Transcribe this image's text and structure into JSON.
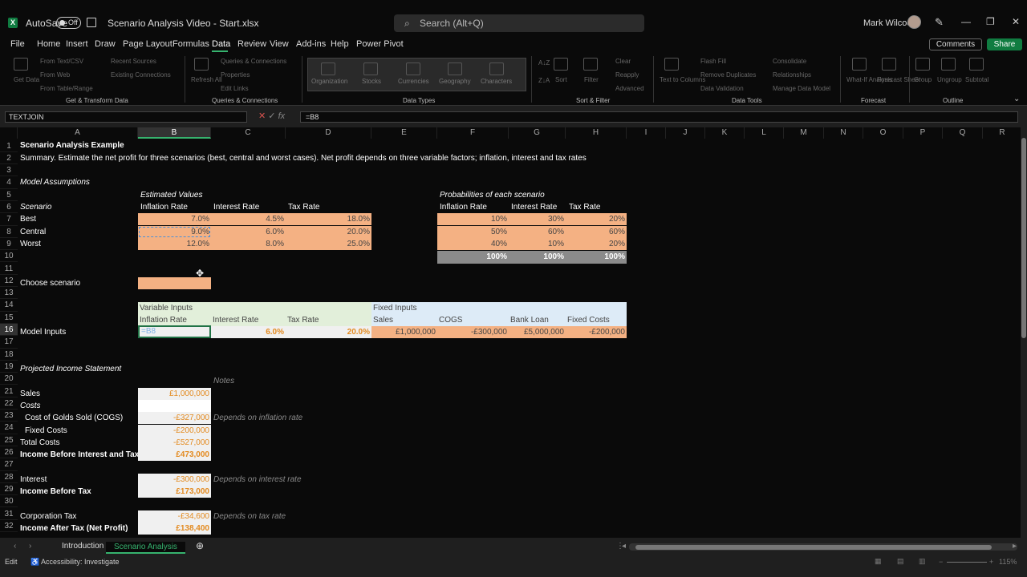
{
  "titlebar": {
    "logo": "X",
    "autosave_label": "AutoSave",
    "autosave_state": "Off",
    "doc_title": "Scenario Analysis Video - Start.xlsx",
    "search_placeholder": "Search (Alt+Q)",
    "user_name": "Mark Wilcock"
  },
  "menu": [
    "File",
    "Home",
    "Insert",
    "Draw",
    "Page Layout",
    "Formulas",
    "Data",
    "Review",
    "View",
    "Add-ins",
    "Help",
    "Power Pivot"
  ],
  "menu_active": "Data",
  "comments_label": "Comments",
  "share_label": "Share",
  "ribbon": {
    "get_data": "Get Data",
    "from_text": "From Text/CSV",
    "from_web": "From Web",
    "from_table": "From Table/Range",
    "recent_sources": "Recent Sources",
    "existing_connections": "Existing Connections",
    "refresh_all": "Refresh All",
    "queries_connections": "Queries & Connections",
    "properties": "Properties",
    "edit_links": "Edit Links",
    "data_types": [
      "Organization",
      "Stocks",
      "Currencies",
      "Geography",
      "Characters"
    ],
    "sort": "Sort",
    "filter": "Filter",
    "clear": "Clear",
    "reapply": "Reapply",
    "advanced": "Advanced",
    "text_to_columns": "Text to Columns",
    "flash_fill": "Flash Fill",
    "remove_duplicates": "Remove Duplicates",
    "data_validation": "Data Validation",
    "consolidate": "Consolidate",
    "relationships": "Relationships",
    "manage_data_model": "Manage Data Model",
    "what_if": "What-If Analysis",
    "forecast_sheet": "Forecast Sheet",
    "group": "Group",
    "ungroup": "Ungroup",
    "subtotal": "Subtotal",
    "groups": [
      "Get & Transform Data",
      "Queries & Connections",
      "Data Types",
      "Sort & Filter",
      "Data Tools",
      "Forecast",
      "Outline"
    ]
  },
  "formula_bar": {
    "name_box": "TEXTJOIN",
    "formula": "=B8"
  },
  "columns": [
    "A",
    "B",
    "C",
    "D",
    "E",
    "F",
    "G",
    "H",
    "I",
    "J",
    "K",
    "L",
    "M",
    "N",
    "O",
    "P",
    "Q",
    "R"
  ],
  "rows": [
    "1",
    "2",
    "3",
    "4",
    "5",
    "6",
    "7",
    "8",
    "9",
    "10",
    "11",
    "12",
    "13",
    "14",
    "15",
    "16",
    "17",
    "18",
    "19",
    "20",
    "21",
    "22",
    "23",
    "24",
    "25",
    "26",
    "27",
    "28",
    "29",
    "30",
    "31",
    "32"
  ],
  "sheet": {
    "title": "Scenario Analysis Example",
    "summary": "Summary.  Estimate the net profit for three scenarios (best, central and worst cases).  Net profit depends on three variable factors; inflation, interest and tax rates",
    "model_assumptions": "Model Assumptions",
    "estimated_values": "Estimated Values",
    "scenario_hdr": "Scenario",
    "inflation_rate": "Inflation Rate",
    "interest_rate": "Interest Rate",
    "tax_rate": "Tax Rate",
    "probabilities": "Probabilities of each scenario",
    "scenarios": [
      {
        "name": "Best",
        "inflation": "7.0%",
        "interest": "4.5%",
        "tax": "18.0%",
        "p_inf": "10%",
        "p_int": "30%",
        "p_tax": "20%"
      },
      {
        "name": "Central",
        "inflation": "9.0%",
        "interest": "6.0%",
        "tax": "20.0%",
        "p_inf": "50%",
        "p_int": "60%",
        "p_tax": "60%"
      },
      {
        "name": "Worst",
        "inflation": "12.0%",
        "interest": "8.0%",
        "tax": "25.0%",
        "p_inf": "40%",
        "p_int": "10%",
        "p_tax": "20%"
      }
    ],
    "totals": [
      "100%",
      "100%",
      "100%"
    ],
    "choose_scenario": "Choose scenario",
    "variable_inputs": "Variable Inputs",
    "fixed_inputs": "Fixed Inputs",
    "sales": "Sales",
    "cogs": "COGS",
    "bank_loan": "Bank Loan",
    "fixed_costs": "Fixed Costs",
    "model_inputs": "Model Inputs",
    "mi_inflation": "=B8",
    "mi_interest": "6.0%",
    "mi_tax": "20.0%",
    "mi_sales": "£1,000,000",
    "mi_cogs": "-£300,000",
    "mi_bank_loan": "£5,000,000",
    "mi_fixed_costs": "-£200,000",
    "projected": "Projected Income Statement",
    "notes": "Notes",
    "is_sales": "Sales",
    "is_sales_v": "£1,000,000",
    "costs": "Costs",
    "cogs_long": "Cost of Golds Sold (COGS)",
    "cogs_v": "-£327,000",
    "cogs_note": "Depends on inflation rate",
    "fixed_costs_lbl": "Fixed Costs",
    "fixed_costs_v": "-£200,000",
    "total_costs": "Total Costs",
    "total_costs_v": "-£527,000",
    "ebit": "Income Before Interest and Tax",
    "ebit_v": "£473,000",
    "interest": "Interest",
    "interest_v": "-£300,000",
    "interest_note": "Depends on interest rate",
    "ibt": "Income Before Tax",
    "ibt_v": "£173,000",
    "corp_tax": "Corporation  Tax",
    "corp_tax_v": "-£34,600",
    "tax_note": "Depends on tax rate",
    "iat": "Income After Tax (Net Profit)",
    "iat_v": "£138,400"
  },
  "tabs": [
    "Introduction",
    "Scenario Analysis"
  ],
  "tab_active": "Scenario Analysis",
  "status": {
    "mode": "Edit",
    "accessibility": "Accessibility: Investigate",
    "zoom": "115%"
  }
}
